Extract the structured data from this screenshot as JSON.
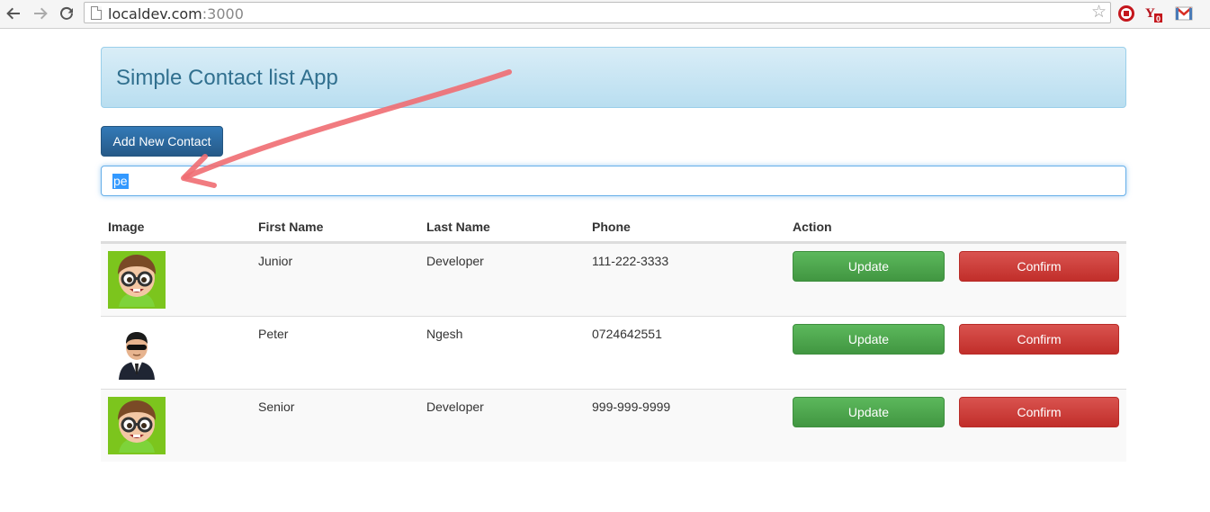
{
  "browser": {
    "url_host": "localdev.com",
    "url_port": ":3000",
    "icons": [
      "back-icon",
      "forward-icon",
      "reload-icon",
      "page-icon",
      "bookmark-star-icon",
      "extension-stop-icon",
      "extension-yahoo-icon",
      "extension-gmail-icon"
    ],
    "yahoo_badge": "0"
  },
  "header": {
    "title": "Simple Contact list App"
  },
  "toolbar": {
    "add_label": "Add New Contact"
  },
  "search": {
    "value": "pe"
  },
  "table": {
    "columns": [
      "Image",
      "First Name",
      "Last Name",
      "Phone",
      "Action"
    ],
    "rows": [
      {
        "avatar": "nerd-avatar",
        "first": "Junior",
        "last": "Developer",
        "phone": "111-222-3333",
        "update": "Update",
        "confirm": "Confirm"
      },
      {
        "avatar": "agent-avatar",
        "first": "Peter",
        "last": "Ngesh",
        "phone": "0724642551",
        "update": "Update",
        "confirm": "Confirm"
      },
      {
        "avatar": "nerd-avatar",
        "first": "Senior",
        "last": "Developer",
        "phone": "999-999-9999",
        "update": "Update",
        "confirm": "Confirm"
      }
    ]
  },
  "colors": {
    "primary": "#337ab7",
    "success": "#5cb85c",
    "danger": "#d9534f",
    "jumbotron": "#d9edf7",
    "annotation_arrow": "#f06d72"
  }
}
